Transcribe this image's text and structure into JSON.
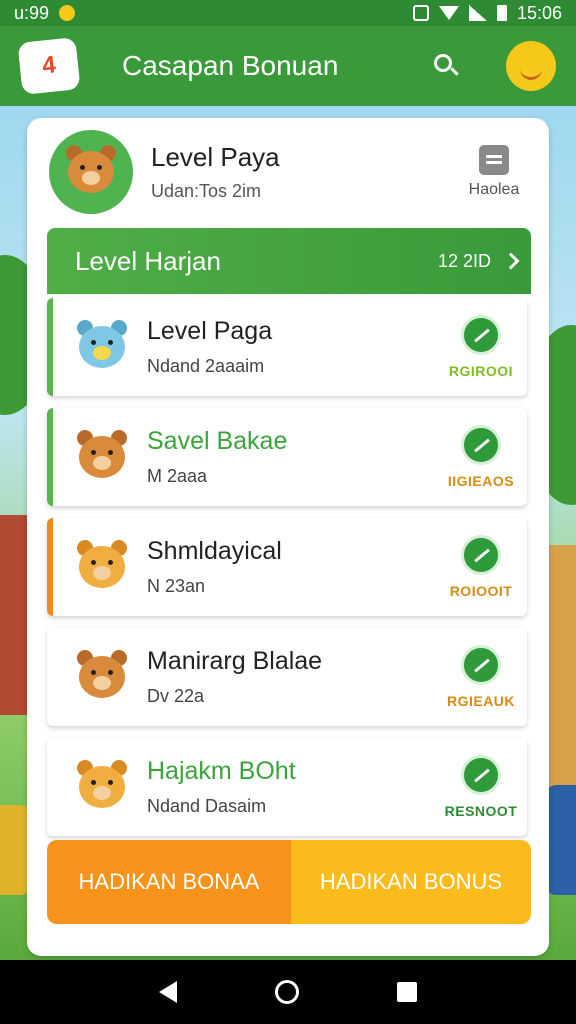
{
  "status_bar": {
    "left_text": "u:99",
    "time": "15:06"
  },
  "app_bar": {
    "logo_text": "4",
    "title": "Casapan Bonuan"
  },
  "profile": {
    "name": "Level Paya",
    "subtitle": "Udan:Tos 2im",
    "side_label": "Haolea"
  },
  "level_header": {
    "title": "Level Harjan",
    "count": "12 2ID"
  },
  "items": [
    {
      "title": "Level Paga",
      "subtitle": "Ndand 2aaaim",
      "action_label": "RGIROOI"
    },
    {
      "title": "Savel Bakae",
      "subtitle": "M 2aaa",
      "action_label": "IIGIEAOS"
    },
    {
      "title": "Shmldayical",
      "subtitle": "N 23an",
      "action_label": "ROIOOIT"
    },
    {
      "title": "Manirarg Blalae",
      "subtitle": "Dv 22a",
      "action_label": "RGIEAUK"
    },
    {
      "title": "Hajakm BOht",
      "subtitle": "Ndand Dasaim",
      "action_label": "RESNOOT"
    }
  ],
  "buttons": {
    "left": "HADIKAN BONAA",
    "right": "HADIKAN BONUS"
  },
  "colors": {
    "primary": "#3a9a3a",
    "orange": "#f7931a",
    "yellow": "#fbbb1c"
  }
}
